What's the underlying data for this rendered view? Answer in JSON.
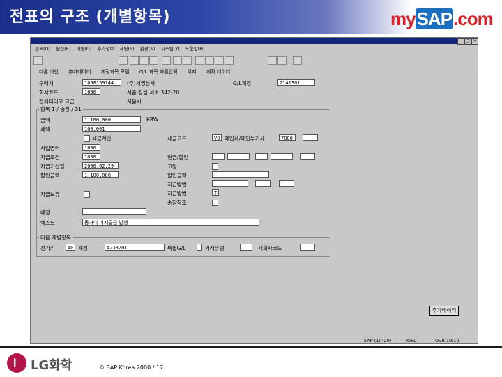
{
  "slide": {
    "title": "전표의 구조 (개별항목)",
    "logo": {
      "my": "my",
      "sap": "SAP",
      "com": ".com"
    },
    "footer_company": "LG화학",
    "copyright": "© SAP Korea 2000 / 17"
  },
  "window": {
    "menu": [
      "전표(D)",
      "편집(E)",
      "이동(G)",
      "추가정보",
      "세팅(S)",
      "환경(N)",
      "시스템(Y)",
      "도움말(H)"
    ],
    "toolbar2": [
      "다른 라인",
      "추가데이터",
      "계정과목 모델",
      "G/L 과목 빠른입력",
      "삭제",
      "계획 데이터"
    ],
    "header": {
      "vendor_label": "구매처",
      "vendor_value": "1058159144",
      "vendor_name": "(주)세영상사",
      "company_label": "회사코드",
      "company_value": "1000",
      "address": "서울 강남 서초 342-20",
      "city": "서울시",
      "tax_label": "전체대리고 고급",
      "gl_label": "G/L계정",
      "gl_value": "2141301"
    },
    "group1": {
      "title": "항목 1 / 송장 / 31",
      "amount_label": "금액",
      "amount_value": "1,100,000",
      "currency": "KRW",
      "tax_amount_label": "세액",
      "tax_amount_value": "100,001",
      "calc_tax_label": "세금계산",
      "bus_area_label": "사업영역",
      "bus_area_value": "1000",
      "pay_terms_label": "지급조건",
      "pay_terms_value": "1000",
      "baseline_label": "지급기산일",
      "baseline_value": "2000.02.29",
      "discount_label": "할인금액",
      "discount_value": "1,100,000",
      "pay_hold_label": "지급보류",
      "tax_code_label": "세금코드",
      "tax_code_value": "V0",
      "tax_code_desc": "매입세/매입부가세",
      "tax_code_extra": "7000",
      "cash_label": "현금/할인",
      "payment_label": "고정",
      "discount_base_label": "할인금액",
      "pay_method_label": "지급방법",
      "pay_block_label": "지급보류",
      "settle_label": "지급방법",
      "settle_value": "T",
      "invoice_ref_label": "송장참조"
    },
    "assignment_label": "배정",
    "text_label": "텍스트",
    "text_value": "동거미 미지급금 발생",
    "group2": {
      "title": "다음 개별항목",
      "posting_key_label": "전기키",
      "posting_key_value": "40",
      "account_label": "계정",
      "account_value": "4233201",
      "special_gl_label": "특별G/L",
      "new_trans_label": "거래유형",
      "new_company_label": "새회사코드"
    },
    "more_button": "추가데이터",
    "status": [
      "SAP (1) (20)",
      "JOEL",
      "OVR 19:19"
    ]
  }
}
